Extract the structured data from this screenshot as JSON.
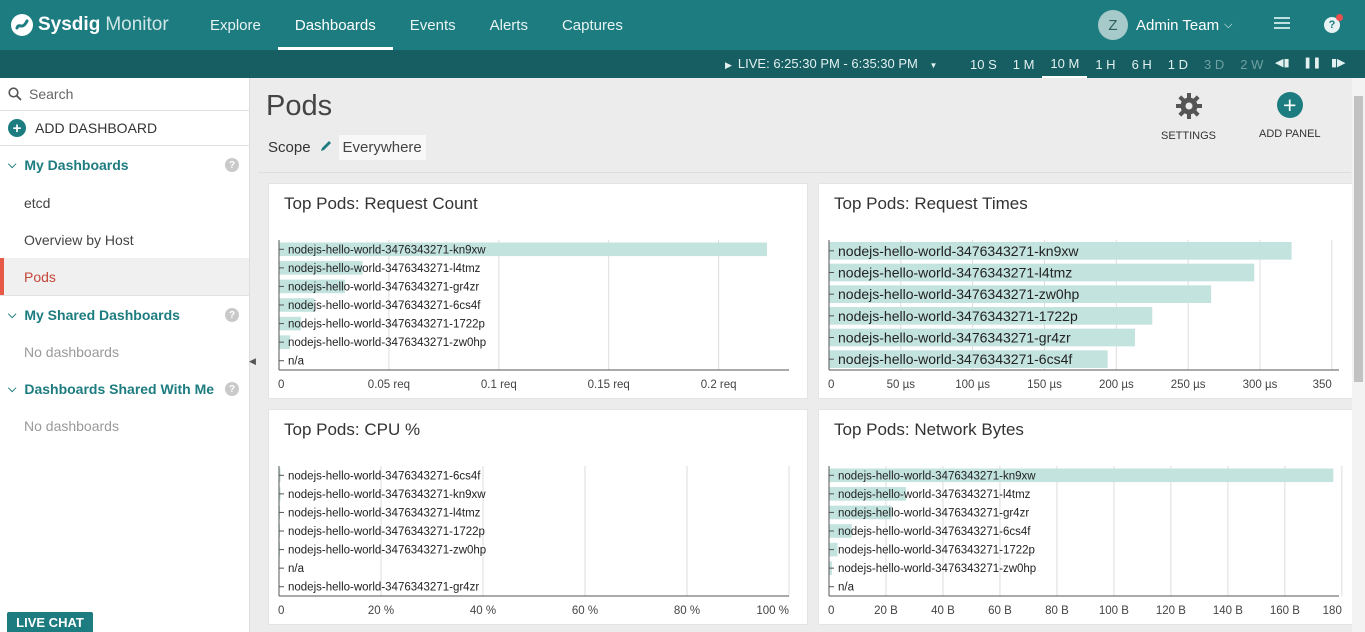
{
  "app": {
    "brand": "Sysdig",
    "product": "Monitor"
  },
  "nav": {
    "items": [
      {
        "label": "Explore",
        "active": false
      },
      {
        "label": "Dashboards",
        "active": true
      },
      {
        "label": "Events",
        "active": false
      },
      {
        "label": "Alerts",
        "active": false
      },
      {
        "label": "Captures",
        "active": false
      }
    ]
  },
  "user": {
    "initial": "Z",
    "name": "Admin Team"
  },
  "timebar": {
    "live_label": "LIVE: 6:25:30 PM - 6:35:30 PM",
    "ranges": [
      {
        "label": "10 S",
        "state": "normal"
      },
      {
        "label": "1 M",
        "state": "normal"
      },
      {
        "label": "10 M",
        "state": "active"
      },
      {
        "label": "1 H",
        "state": "normal"
      },
      {
        "label": "6 H",
        "state": "normal"
      },
      {
        "label": "1 D",
        "state": "normal"
      },
      {
        "label": "3 D",
        "state": "dim"
      },
      {
        "label": "2 W",
        "state": "dim"
      }
    ]
  },
  "sidebar": {
    "search_placeholder": "Search",
    "add_dashboard": "ADD DASHBOARD",
    "my_dashboards": {
      "title": "My Dashboards",
      "items": [
        "etcd",
        "Overview by Host",
        "Pods"
      ],
      "active": "Pods"
    },
    "my_shared": {
      "title": "My Shared Dashboards",
      "empty": "No dashboards"
    },
    "shared_with_me": {
      "title": "Dashboards Shared With Me",
      "empty": "No dashboards"
    },
    "live_chat": "LIVE CHAT"
  },
  "page": {
    "title": "Pods",
    "scope_label": "Scope",
    "scope_value": "Everywhere",
    "settings_label": "SETTINGS",
    "add_panel_label": "ADD PANEL"
  },
  "colors": {
    "accent": "#1d7c80",
    "bar": "#c3e3de",
    "active_item": "#e65a47"
  },
  "chart_data": [
    {
      "type": "bar",
      "orientation": "horizontal",
      "title": "Top Pods: Request Count",
      "categories": [
        "nodejs-hello-world-3476343271-kn9xw",
        "nodejs-hello-world-3476343271-l4tmz",
        "nodejs-hello-world-3476343271-gr4zr",
        "nodejs-hello-world-3476343271-6cs4f",
        "nodejs-hello-world-3476343271-1722p",
        "nodejs-hello-world-3476343271-zw0hp",
        "n/a"
      ],
      "values": [
        0.222,
        0.038,
        0.03,
        0.016,
        0.01,
        0.005,
        0
      ],
      "ticks": [
        0,
        0.05,
        0.1,
        0.15,
        0.2
      ],
      "tick_labels": [
        "0",
        "0.05 req",
        "0.1 req",
        "0.15 req",
        "0.2 req"
      ],
      "xlim": [
        0,
        0.232
      ]
    },
    {
      "type": "bar",
      "orientation": "horizontal",
      "title": "Top Pods: Request Times",
      "categories": [
        "nodejs-hello-world-3476343271-kn9xw",
        "nodejs-hello-world-3476343271-l4tmz",
        "nodejs-hello-world-3476343271-zw0hp",
        "nodejs-hello-world-3476343271-1722p",
        "nodejs-hello-world-3476343271-gr4zr",
        "nodejs-hello-world-3476343271-6cs4f"
      ],
      "values": [
        322,
        296,
        266,
        225,
        213,
        194
      ],
      "ticks": [
        0,
        50,
        100,
        150,
        200,
        250,
        300,
        350
      ],
      "tick_labels": [
        "0",
        "50 µs",
        "100 µs",
        "150 µs",
        "200 µs",
        "250 µs",
        "300 µs",
        "350"
      ],
      "xlim": [
        0,
        355
      ]
    },
    {
      "type": "bar",
      "orientation": "horizontal",
      "title": "Top Pods: CPU %",
      "categories": [
        "nodejs-hello-world-3476343271-6cs4f",
        "nodejs-hello-world-3476343271-kn9xw",
        "nodejs-hello-world-3476343271-l4tmz",
        "nodejs-hello-world-3476343271-1722p",
        "nodejs-hello-world-3476343271-zw0hp",
        "n/a",
        "nodejs-hello-world-3476343271-gr4zr"
      ],
      "values": [
        0.3,
        0.3,
        0.2,
        0.2,
        0.2,
        0,
        0.1
      ],
      "ticks": [
        0,
        20,
        40,
        60,
        80,
        100
      ],
      "tick_labels": [
        "0",
        "20 %",
        "40 %",
        "60 %",
        "80 %",
        "100 %"
      ],
      "xlim": [
        0,
        100
      ]
    },
    {
      "type": "bar",
      "orientation": "horizontal",
      "title": "Top Pods: Network Bytes",
      "categories": [
        "nodejs-hello-world-3476343271-kn9xw",
        "nodejs-hello-world-3476343271-l4tmz",
        "nodejs-hello-world-3476343271-gr4zr",
        "nodejs-hello-world-3476343271-6cs4f",
        "nodejs-hello-world-3476343271-1722p",
        "nodejs-hello-world-3476343271-zw0hp",
        "n/a"
      ],
      "values": [
        177,
        27,
        22,
        8,
        3,
        1,
        0
      ],
      "ticks": [
        0,
        20,
        40,
        60,
        80,
        100,
        120,
        140,
        160,
        180
      ],
      "tick_labels": [
        "0",
        "20 B",
        "40 B",
        "60 B",
        "80 B",
        "100 B",
        "120 B",
        "140 B",
        "160 B",
        "180"
      ],
      "xlim": [
        0,
        179
      ]
    }
  ]
}
